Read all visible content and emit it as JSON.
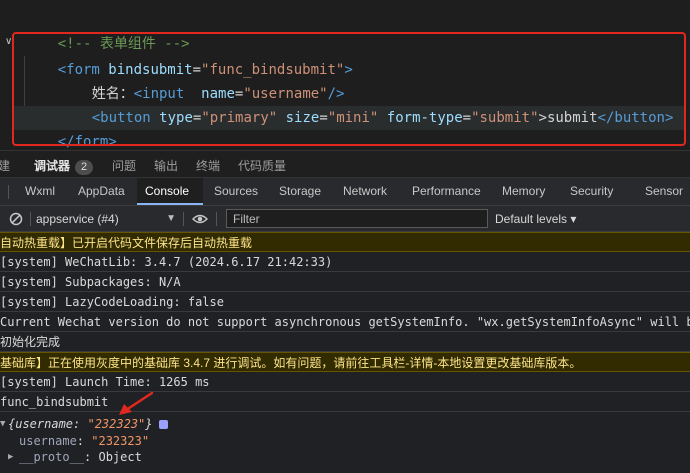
{
  "editor": {
    "comment": "<!-- 表单组件 -->",
    "form_open": {
      "tag_open": "<form ",
      "attr": "bindsubmit",
      "eq": "=",
      "val": "\"func_bindsubmit\"",
      "tag_close": ">"
    },
    "input_line": {
      "label": "姓名：",
      "tag_open": "<input  ",
      "attr": "name",
      "eq": "=",
      "val": "\"username\"",
      "tag_close": "/>"
    },
    "button_line": {
      "tag_open": "<button ",
      "attr1": "type",
      "val1": "\"primary\"",
      "attr2": "size",
      "val2": "\"mini\"",
      "attr3": "form-type",
      "val3": "\"submit\"",
      "eq": "=",
      "text": ">submit",
      "tag_end": "</button>"
    },
    "form_close": "</form>"
  },
  "panel_tabs": [
    {
      "label": "建"
    },
    {
      "label": "调试器",
      "badge": "2",
      "active": true
    },
    {
      "label": "问题"
    },
    {
      "label": "输出"
    },
    {
      "label": "终端"
    },
    {
      "label": "代码质量"
    }
  ],
  "devtools_tabs": [
    "Wxml",
    "AppData",
    "Console",
    "Sources",
    "Storage",
    "Network",
    "Performance",
    "Memory",
    "Security",
    "Sensor"
  ],
  "devtools_active": "Console",
  "toolbar": {
    "context": "appservice (#4)",
    "filter_placeholder": "Filter",
    "levels": "Default levels ▾"
  },
  "console_lines": [
    {
      "text": "自动热重载】已开启代码文件保存后自动热重载",
      "level": "warn"
    },
    {
      "text": "[system] WeChatLib: 3.4.7 (2024.6.17 21:42:33)",
      "level": "log"
    },
    {
      "text": "[system] Subpackages: N/A",
      "level": "log"
    },
    {
      "text": "[system] LazyCodeLoading: false",
      "level": "log"
    },
    {
      "text": "Current Wechat version do not support asynchronous getSystemInfo. \"wx.getSystemInfoAsync\" will be finished",
      "level": "log"
    },
    {
      "text": "初始化完成",
      "level": "log"
    },
    {
      "text": "基础库】正在使用灰度中的基础库 3.4.7 进行调试。如有问题，请前往工具栏-详情-本地设置更改基础库版本。",
      "level": "warn"
    },
    {
      "text": "[system] Launch Time: 1265 ms",
      "level": "log"
    },
    {
      "text": "func_bindsubmit",
      "level": "log"
    }
  ],
  "object": {
    "summary_prefix": "{username: ",
    "summary_value": "\"232323\"",
    "summary_suffix": "}",
    "key": "username",
    "colon": ": ",
    "value": "\"232323\"",
    "proto_key": "__proto__",
    "proto_value": ": Object"
  },
  "colors": {
    "highlight_box": "#e0281e",
    "annotation_arrow": "#e0281e",
    "warn_background": "#332b00",
    "active_tab_underline": "#8ab4f8"
  }
}
